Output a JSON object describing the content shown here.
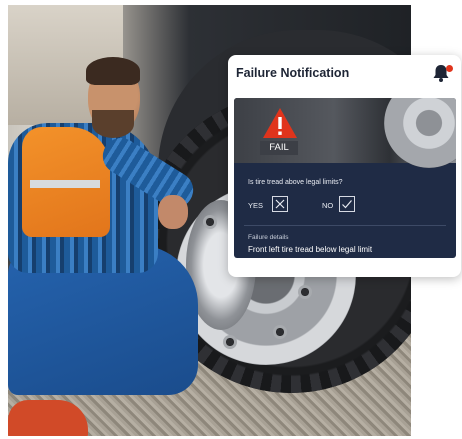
{
  "notification": {
    "title": "Failure Notification",
    "status_label": "FAIL",
    "question": "Is tire tread above legal limits?",
    "options": [
      {
        "label": "YES",
        "icon": "x-mark-icon"
      },
      {
        "label": "NO",
        "icon": "check-icon"
      }
    ],
    "details_label": "Failure details",
    "details_text": "Front left tire tread below legal limit"
  },
  "colors": {
    "panel": "#1f2b45",
    "warning": "#e0341c",
    "card": "#ffffff",
    "title": "#1e2535"
  }
}
